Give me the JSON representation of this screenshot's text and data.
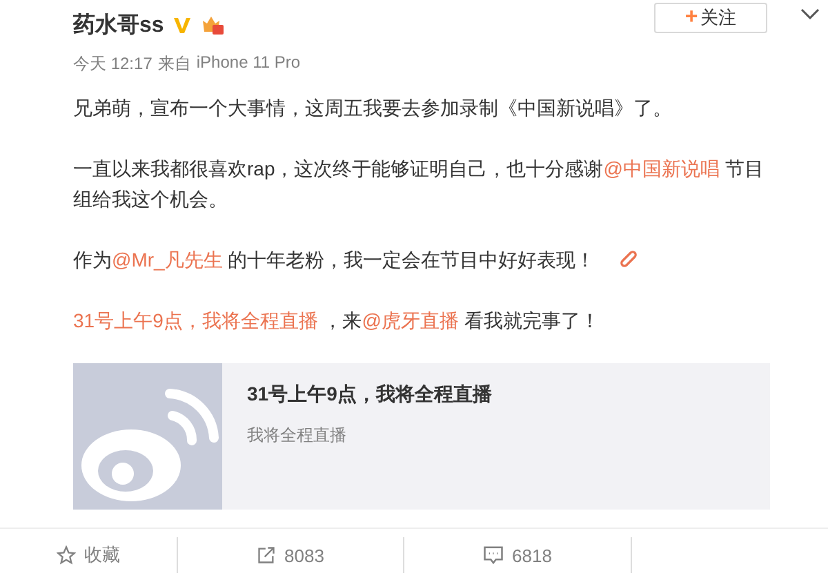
{
  "author": {
    "name": "药水哥ss",
    "time": "今天 12:17",
    "source_prefix": "来自",
    "source": "iPhone 11 Pro"
  },
  "follow_button": {
    "plus": "+",
    "label": "关注"
  },
  "paragraphs": [
    {
      "segments": [
        {
          "kind": "text",
          "text": "兄弟萌，宣布一个大事情，这周五我要去参加录制《中国新说唱》了。"
        }
      ]
    },
    {
      "segments": [
        {
          "kind": "text",
          "text": "一直以来我都很喜欢rap，这次终于能够证明自己，也十分感谢"
        },
        {
          "kind": "link",
          "text": "@中国新说唱"
        },
        {
          "kind": "text",
          "text": " 节目组给我这个机会。"
        }
      ]
    },
    {
      "segments": [
        {
          "kind": "text",
          "text": "作为"
        },
        {
          "kind": "link",
          "text": "@Mr_凡先生"
        },
        {
          "kind": "text",
          "text": " 的十年老粉，我一定会在节目中好好表现！"
        }
      ],
      "link_icon": true
    },
    {
      "segments": [
        {
          "kind": "link",
          "text": "31号上午9点，我将全程直播"
        },
        {
          "kind": "text",
          "text": " ，来"
        },
        {
          "kind": "link",
          "text": "@虎牙直播"
        },
        {
          "kind": "text",
          "text": " 看我就完事了！"
        }
      ]
    }
  ],
  "card": {
    "title": "31号上午9点，我将全程直播",
    "subtitle": "我将全程直播"
  },
  "actions": [
    {
      "kind": "favorite",
      "label": "收藏"
    },
    {
      "kind": "repost",
      "label": "8083"
    },
    {
      "kind": "comment",
      "label": "6818"
    }
  ]
}
